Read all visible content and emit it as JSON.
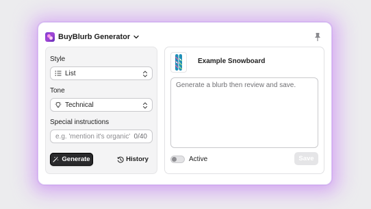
{
  "app": {
    "title": "BuyBlurb Generator",
    "accent_color": "#7d3ecf"
  },
  "form": {
    "style": {
      "label": "Style",
      "value": "List",
      "icon": "list-icon"
    },
    "tone": {
      "label": "Tone",
      "value": "Technical",
      "icon": "lightbulb-icon"
    },
    "special_instructions": {
      "label": "Special instructions",
      "placeholder": "e.g. 'mention it's organic'",
      "counter": "0/40"
    },
    "generate_button": "Generate",
    "history_button": "History"
  },
  "product": {
    "name": "Example Snowboard"
  },
  "blurb": {
    "placeholder": "Generate a blurb then review and save."
  },
  "active_toggle": {
    "label": "Active",
    "on": false
  },
  "save_button": "Save"
}
